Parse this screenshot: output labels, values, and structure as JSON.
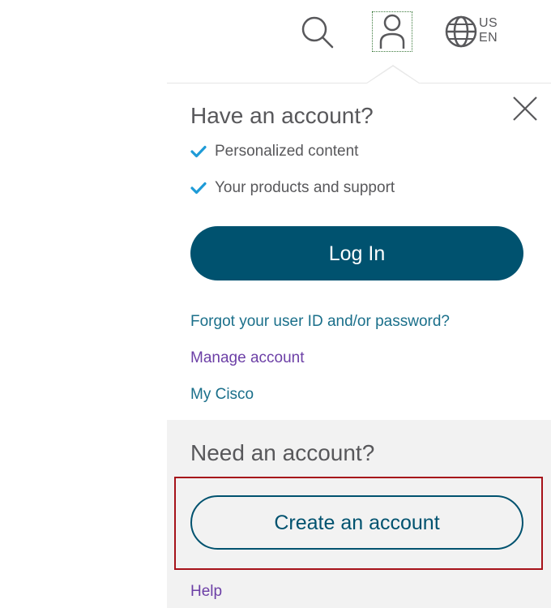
{
  "header": {
    "icons": [
      "search-icon",
      "account-icon",
      "globe-icon"
    ],
    "locale_country": "US",
    "locale_language": "EN"
  },
  "dropdown": {
    "have_account_heading": "Have an account?",
    "benefits": [
      {
        "icon": "check-icon",
        "label": "Personalized content"
      },
      {
        "icon": "check-icon",
        "label": "Your products and support"
      }
    ],
    "login_label": "Log In",
    "links": {
      "forgot": "Forgot your user ID and/or password?",
      "manage": "Manage account",
      "my_cisco": "My Cisco"
    },
    "need_account_heading": "Need an account?",
    "create_account_label": "Create an account",
    "help_label": "Help",
    "close_icon": "close-icon"
  },
  "colors": {
    "brand_blue": "#00526f",
    "link_teal": "#1a6f8a",
    "link_purple": "#6c3fa6",
    "check_blue": "#1e9bd7",
    "highlight_red": "#a6121a",
    "text_gray": "#58585b"
  }
}
